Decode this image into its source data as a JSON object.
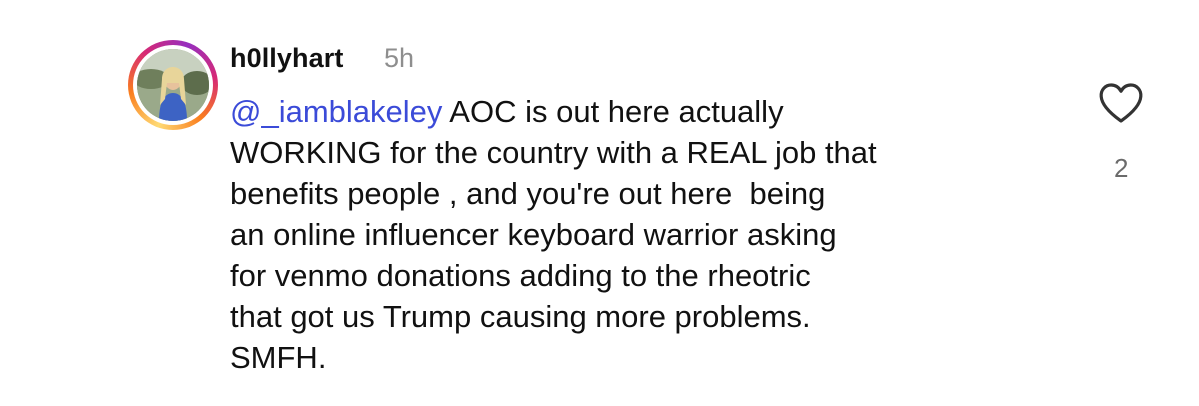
{
  "comment": {
    "username": "h0llyhart",
    "timestamp": "5h",
    "mention": "@_iamblakeley",
    "lines": [
      " AOC is out here actually",
      "WORKING for the country with a REAL job that",
      "benefits people , and you're out here  being",
      "an online influencer keyboard warrior asking",
      "for venmo donations adding to the rheotric",
      "that got us Trump causing more problems.",
      "SMFH."
    ],
    "like_icon": "heart-outline-icon",
    "like_count": "2"
  },
  "colors": {
    "mention": "#3b4bd8",
    "timestamp": "#8e8e8e",
    "like_count": "#6b6b6b",
    "ring_gradient": [
      "#feda75",
      "#fa7e1e",
      "#d62976",
      "#962fbf"
    ]
  }
}
